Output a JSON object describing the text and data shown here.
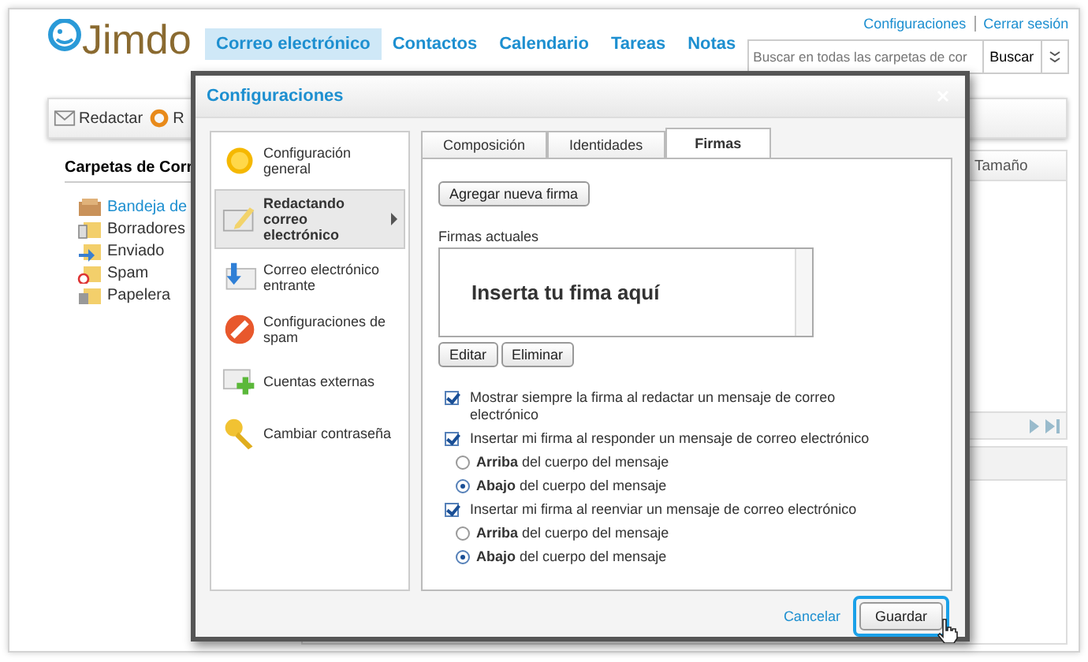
{
  "app": {
    "logo": "Jimdo",
    "nav": [
      {
        "label": "Correo electrónico",
        "selected": true
      },
      {
        "label": "Contactos",
        "selected": false
      },
      {
        "label": "Calendario",
        "selected": false
      },
      {
        "label": "Tareas",
        "selected": false
      },
      {
        "label": "Notas",
        "selected": false
      }
    ],
    "top_links": [
      "Configuraciones",
      "Cerrar sesión"
    ],
    "search": {
      "placeholder": "Buscar en todas las carpetas de cor",
      "button": "Buscar"
    },
    "toolbar": [
      {
        "label": "Redactar",
        "kind": "compose"
      },
      {
        "label": "R",
        "kind": "reply"
      }
    ],
    "sidebar": {
      "title": "Carpetas de Corr",
      "folders": [
        {
          "label": "Bandeja de",
          "kind": "inbox",
          "selected": true
        },
        {
          "label": "Borradores",
          "kind": "drafts",
          "selected": false
        },
        {
          "label": "Enviado",
          "kind": "sent",
          "selected": false
        },
        {
          "label": "Spam",
          "kind": "spam",
          "selected": false
        },
        {
          "label": "Papelera",
          "kind": "trash",
          "selected": false
        }
      ]
    },
    "mail_list": {
      "column": "Tamaño"
    }
  },
  "dialog": {
    "title": "Configuraciones",
    "nav": [
      {
        "label": "Configuración general",
        "kind": "general",
        "selected": false
      },
      {
        "label": "Redactando correo electrónico",
        "kind": "compose",
        "selected": true
      },
      {
        "label": "Correo electrónico entrante",
        "kind": "incoming",
        "selected": false
      },
      {
        "label": "Configuraciones de spam",
        "kind": "spam",
        "selected": false
      },
      {
        "label": "Cuentas externas",
        "kind": "accounts",
        "selected": false
      },
      {
        "label": "Cambiar contraseña",
        "kind": "password",
        "selected": false
      }
    ],
    "tabs": [
      {
        "label": "Composición",
        "selected": false
      },
      {
        "label": "Identidades",
        "selected": false
      },
      {
        "label": "Firmas",
        "selected": true
      }
    ],
    "add_button": "Agregar nueva firma",
    "signatures_label": "Firmas actuales",
    "signature": "Inserta tu fima aquí",
    "signature_buttons": [
      "Editar",
      "Eliminar"
    ],
    "options": [
      {
        "kind": "checkbox",
        "label": "Mostrar siempre la firma al redactar un mensaje de correo electrónico",
        "checked": true
      },
      {
        "kind": "checkbox",
        "label": "Insertar mi firma al responder un mensaje de correo electrónico",
        "checked": true
      },
      {
        "kind": "radio",
        "label": "**Arriba** del cuerpo del mensaje",
        "selected": false
      },
      {
        "kind": "radio",
        "label": "**Abajo** del cuerpo del mensaje",
        "selected": true
      },
      {
        "kind": "checkbox",
        "label": "Insertar mi firma al reenviar un mensaje de correo electrónico",
        "checked": true
      },
      {
        "kind": "radio",
        "label": "**Arriba** del cuerpo del mensaje",
        "selected": false
      },
      {
        "kind": "radio",
        "label": "**Abajo** del cuerpo del mensaje",
        "selected": true
      }
    ],
    "cancel": "Cancelar",
    "save": "Guardar"
  }
}
